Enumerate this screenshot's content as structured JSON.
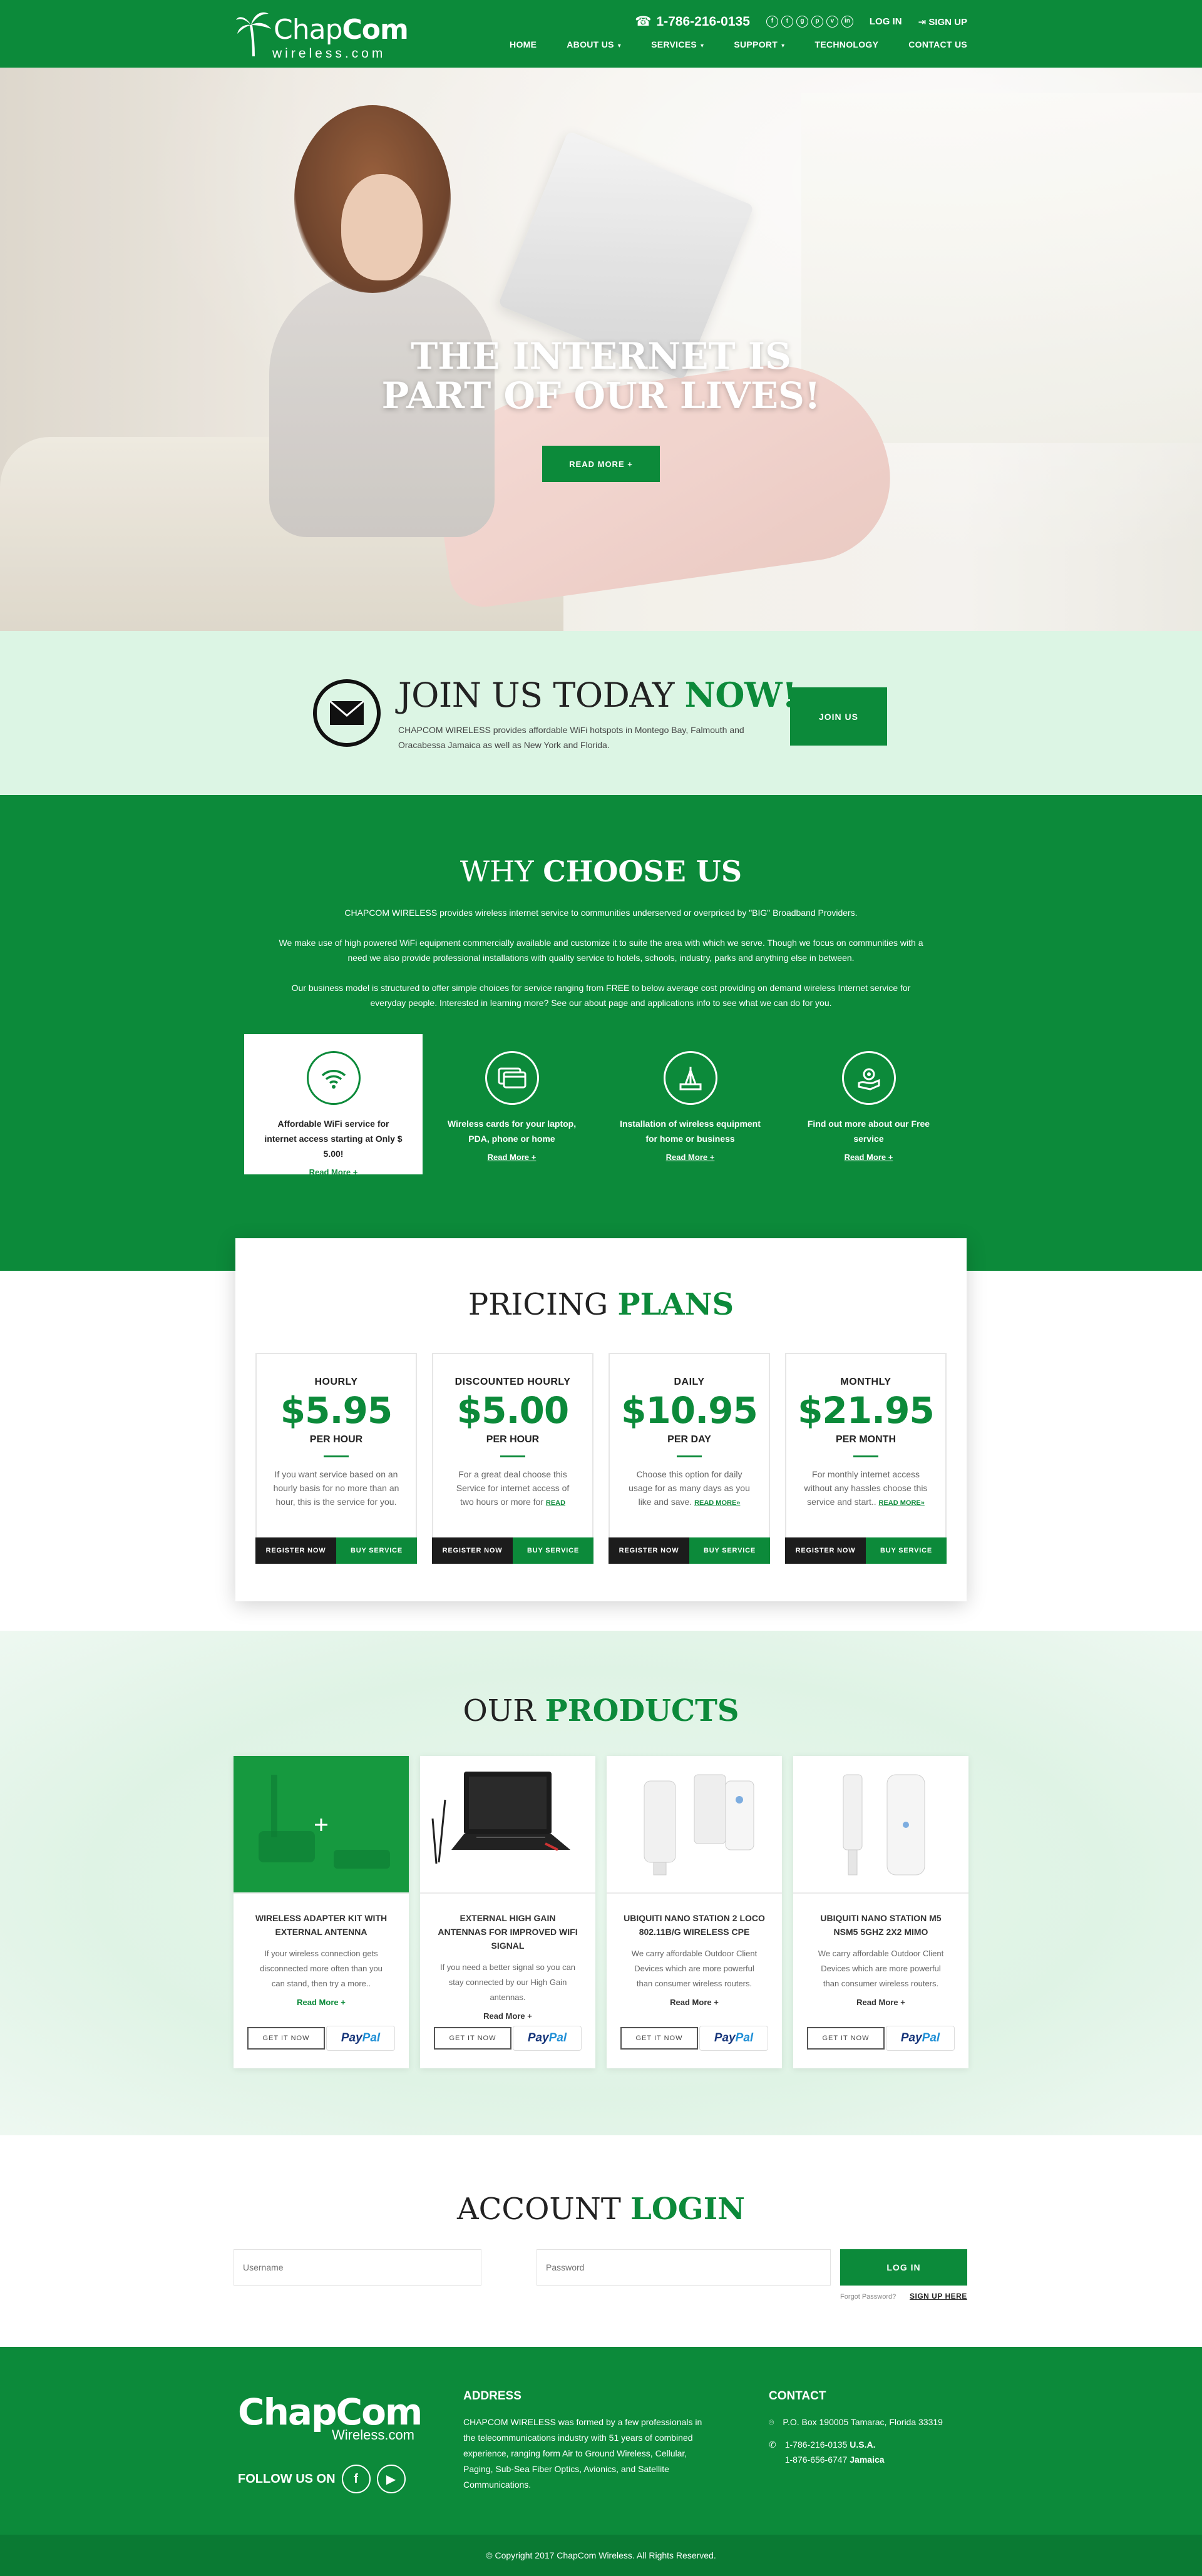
{
  "brand": {
    "name_light": "Chap",
    "name_bold": "Com",
    "sub": "wireless.com"
  },
  "header": {
    "phone": "1-786-216-0135",
    "social": [
      "f",
      "t",
      "g",
      "p",
      "v",
      "in"
    ],
    "login": "LOG IN",
    "signup": "SIGN UP",
    "nav": [
      {
        "label": "HOME",
        "caret": false
      },
      {
        "label": "ABOUT US",
        "caret": true
      },
      {
        "label": "SERVICES",
        "caret": true
      },
      {
        "label": "SUPPORT",
        "caret": true
      },
      {
        "label": "TECHNOLOGY",
        "caret": false
      },
      {
        "label": "CONTACT US",
        "caret": false
      }
    ]
  },
  "hero": {
    "line1_a": "THE ",
    "line1_b": "INTERNET",
    "line1_c": " IS",
    "line2_a": "PART",
    "line2_b": " OF ",
    "line2_c": "OUR LIVES!",
    "button": "READ MORE +"
  },
  "join": {
    "title_a": "JOIN US TODAY ",
    "title_b": "NOW!",
    "text": "CHAPCOM WIRELESS provides affordable WiFi hotspots in Montego Bay, Falmouth and Oracabessa Jamaica as well as New York and Florida.",
    "button": "JOIN US"
  },
  "why": {
    "title_a": "WHY ",
    "title_b": "CHOOSE US",
    "paragraphs": [
      "CHAPCOM WIRELESS provides wireless internet service to communities underserved or overpriced by \"BIG\" Broadband Providers.",
      "We make use of high powered WiFi equipment commercially available and customize it to suite the area with which we serve. Though we focus on communities with a need we also provide professional installations with quality service to hotels, schools, industry, parks and anything else in between.",
      "Our business model is structured to offer simple choices for service ranging from FREE to below average cost providing on demand wireless Internet service for everyday people. Interested in learning more? See our about page and applications info to see what we can do for you."
    ],
    "features": [
      {
        "icon": "wifi-icon",
        "text": "Affordable WiFi service for internet access starting at Only $ 5.00!",
        "more": "Read More +"
      },
      {
        "icon": "card-icon",
        "text": "Wireless cards for your laptop, PDA, phone or home",
        "more": "Read More +"
      },
      {
        "icon": "tower-icon",
        "text": "Installation of wireless equipment for home or business",
        "more": "Read More +"
      },
      {
        "icon": "hand-gear-icon",
        "text": "Find out more about our Free service",
        "more": "Read More +"
      }
    ]
  },
  "pricing": {
    "title_a": "PRICING ",
    "title_b": "PLANS",
    "plans": [
      {
        "name": "HOURLY",
        "price": "$5.95",
        "per": "PER HOUR",
        "desc": "If you want service based on an hourly basis for no more than an hour, this is the service for you.",
        "more": "",
        "register": "REGISTER NOW",
        "buy": "BUY SERVICE"
      },
      {
        "name": "DISCOUNTED HOURLY",
        "price": "$5.00",
        "per": "PER HOUR",
        "desc": "For a great deal choose this Service for internet access of two hours or more for ",
        "more": "READ MORE»",
        "register": "REGISTER NOW",
        "buy": "BUY SERVICE"
      },
      {
        "name": "DAILY",
        "price": "$10.95",
        "per": "PER DAY",
        "desc": "Choose this option for daily usage for as many days as you like and save. ",
        "more": "READ MORE»",
        "register": "REGISTER NOW",
        "buy": "BUY SERVICE"
      },
      {
        "name": "MONTHLY",
        "price": "$21.95",
        "per": "PER MONTH",
        "desc": "For monthly internet access without any hassles choose this service and start.. ",
        "more": "READ MORE»",
        "register": "REGISTER NOW",
        "buy": "BUY SERVICE"
      }
    ]
  },
  "products": {
    "title_a": "OUR ",
    "title_b": "PRODUCTS",
    "items": [
      {
        "name": "WIRELESS ADAPTER KIT WITH EXTERNAL ANTENNA",
        "desc": "If your wireless connection gets disconnected more often than you can stand, then try a more..",
        "more": "Read More +",
        "get": "GET IT NOW",
        "pay_a": "Pay",
        "pay_b": "Pal"
      },
      {
        "name": "EXTERNAL HIGH GAIN ANTENNAS FOR IMPROVED WIFI SIGNAL",
        "desc": "If you need a better signal so you can stay connected by our High Gain antennas.",
        "more": "Read More +",
        "get": "GET IT NOW",
        "pay_a": "Pay",
        "pay_b": "Pal"
      },
      {
        "name": "UBIQUITI NANO STATION 2 LOCO 802.11B/G WIRELESS CPE",
        "desc": "We carry affordable Outdoor Client Devices which are more powerful than consumer wireless routers.",
        "more": "Read More +",
        "get": "GET IT NOW",
        "pay_a": "Pay",
        "pay_b": "Pal"
      },
      {
        "name": "UBIQUITI NANO STATION M5 NSM5 5GHZ 2X2 MIMO",
        "desc": "We carry affordable Outdoor Client Devices which are more powerful than consumer wireless routers.",
        "more": "Read More +",
        "get": "GET IT NOW",
        "pay_a": "Pay",
        "pay_b": "Pal"
      }
    ]
  },
  "login": {
    "title_a": "ACCOUNT ",
    "title_b": "LOGIN",
    "username_placeholder": "Username",
    "password_placeholder": "Password",
    "button": "LOG IN",
    "forgot": "Forgot Password?",
    "signup": "SIGN UP HERE"
  },
  "footer": {
    "brand": "ChapCom",
    "sub": "Wireless.com",
    "follow": "FOLLOW US ON",
    "address_title": "ADDRESS",
    "address_text": "CHAPCOM WIRELESS was formed by a few professionals in the telecommunications industry with 51 years of combined experience, ranging form Air to Ground Wireless, Cellular, Paging, Sub-Sea Fiber Optics, Avionics, and Satellite Communications.",
    "contact_title": "CONTACT",
    "po_box": "P.O. Box 190005 Tamarac, Florida 33319",
    "phone_us": "1-786-216-0135",
    "phone_us_tag": "U.S.A.",
    "phone_jm": "1-876-656-6747",
    "phone_jm_tag": "Jamaica",
    "copyright": "© Copyright 2017 ChapCom Wireless. All Rights Reserved."
  },
  "colors": {
    "brand_green": "#0c8a3a",
    "join_bg": "#dcf5e4"
  }
}
